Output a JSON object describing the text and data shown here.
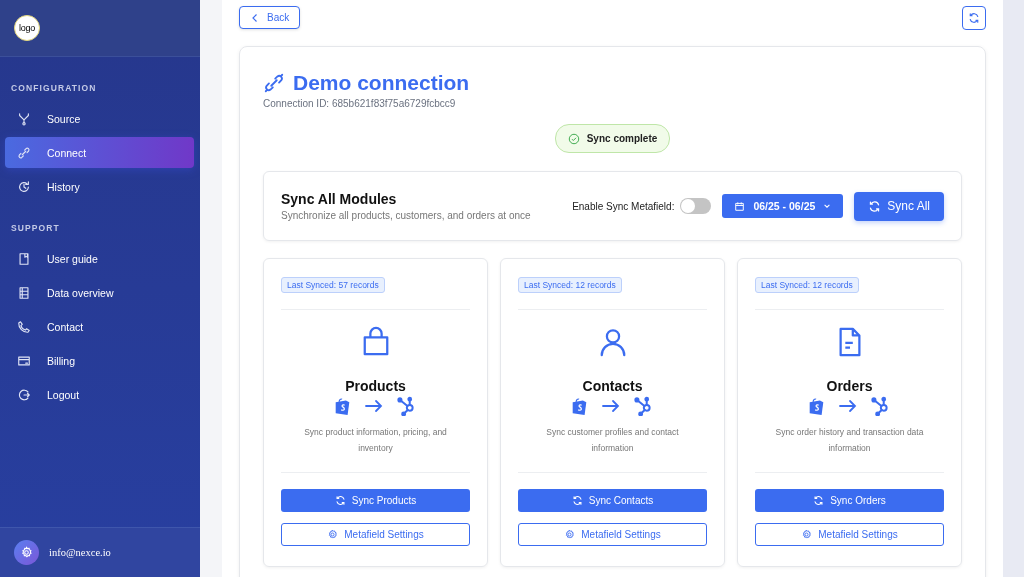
{
  "sidebar": {
    "logo": "logo",
    "sections": [
      {
        "heading": "CONFIGURATION",
        "items": [
          {
            "label": "Source",
            "kind": "source",
            "selected": false
          },
          {
            "label": "Connect",
            "kind": "connect",
            "selected": true
          },
          {
            "label": "History",
            "kind": "history",
            "selected": false
          }
        ]
      },
      {
        "heading": "SUPPORT",
        "items": [
          {
            "label": "User guide",
            "kind": "guide",
            "selected": false
          },
          {
            "label": "Data overview",
            "kind": "data",
            "selected": false
          },
          {
            "label": "Contact",
            "kind": "contact",
            "selected": false
          },
          {
            "label": "Billing",
            "kind": "billing",
            "selected": false
          },
          {
            "label": "Logout",
            "kind": "logout",
            "selected": false
          }
        ]
      }
    ],
    "user": {
      "email": "info@nexce.io"
    }
  },
  "toolbar": {
    "back": "Back"
  },
  "connection": {
    "title": "Demo connection",
    "id": "Connection ID: 685b621f83f75a6729fcbcc9",
    "status": "Sync complete"
  },
  "sync_all": {
    "title": "Sync All Modules",
    "subtitle": "Synchronize all products, customers, and orders at once",
    "toggle_label": "Enable Sync Metafield:",
    "toggle_on": false,
    "date_range": "06/25 - 06/25",
    "button": "Sync All"
  },
  "modules": [
    {
      "kind": "products",
      "badge": "Last Synced: 57 records",
      "title": "Products",
      "description": "Sync product information, pricing, and inventory",
      "sync_button": "Sync Products",
      "settings_button": "Metafield Settings"
    },
    {
      "kind": "contacts",
      "badge": "Last Synced: 12 records",
      "title": "Contacts",
      "description": "Sync customer profiles and contact information",
      "sync_button": "Sync Contacts",
      "settings_button": "Metafield Settings"
    },
    {
      "kind": "orders",
      "badge": "Last Synced: 12 records",
      "title": "Orders",
      "description": "Sync order history and transaction data information",
      "sync_button": "Sync Orders",
      "settings_button": "Metafield Settings"
    }
  ]
}
